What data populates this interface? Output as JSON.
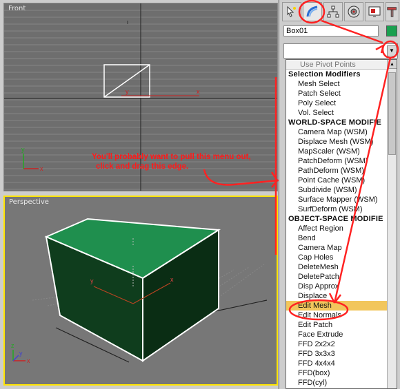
{
  "viewports": {
    "front": {
      "label": "Front",
      "axis_x": "x",
      "axis_y": "y",
      "gizmo_x": "x",
      "gizmo_y": "y"
    },
    "perspective": {
      "label": "Perspective",
      "axis_x": "x",
      "axis_y": "y",
      "gizmo_x": "x",
      "gizmo_y": "y",
      "gizmo_z": "z"
    }
  },
  "command_panel": {
    "tabs": [
      {
        "name": "create-tab",
        "icon": "pointer-star-icon"
      },
      {
        "name": "modify-tab",
        "icon": "modify-rainbow-icon"
      },
      {
        "name": "hierarchy-tab",
        "icon": "hierarchy-icon"
      },
      {
        "name": "motion-tab",
        "icon": "motion-icon"
      },
      {
        "name": "display-tab",
        "icon": "display-icon"
      },
      {
        "name": "utilities-tab",
        "icon": "hammer-icon"
      }
    ],
    "object_name": "Box01",
    "object_color": "#1aa050",
    "modifier_list": {
      "value": "",
      "use_pivot_points": "Use Pivot Points",
      "items": [
        {
          "label": "Selection Modifiers",
          "header": true
        },
        {
          "label": "Mesh Select"
        },
        {
          "label": "Patch Select"
        },
        {
          "label": "Poly Select"
        },
        {
          "label": "Vol. Select"
        },
        {
          "label": "WORLD-SPACE MODIFIE",
          "header": true
        },
        {
          "label": "Camera Map (WSM)"
        },
        {
          "label": "Displace Mesh (WSM)"
        },
        {
          "label": "MapScaler (WSM)"
        },
        {
          "label": "PatchDeform (WSM)"
        },
        {
          "label": "PathDeform (WSM)"
        },
        {
          "label": "Point Cache (WSM)"
        },
        {
          "label": "Subdivide (WSM)"
        },
        {
          "label": "Surface Mapper (WSM)"
        },
        {
          "label": "SurfDeform (WSM)"
        },
        {
          "label": "OBJECT-SPACE MODIFIE",
          "header": true
        },
        {
          "label": "Affect Region"
        },
        {
          "label": "Bend"
        },
        {
          "label": "Camera Map"
        },
        {
          "label": "Cap Holes"
        },
        {
          "label": "DeleteMesh"
        },
        {
          "label": "DeletePatch"
        },
        {
          "label": "Disp Approx"
        },
        {
          "label": "Displace"
        },
        {
          "label": "Edit Mesh",
          "selected": true
        },
        {
          "label": "Edit Normals"
        },
        {
          "label": "Edit Patch"
        },
        {
          "label": "Face Extrude"
        },
        {
          "label": "FFD 2x2x2"
        },
        {
          "label": "FFD 3x3x3"
        },
        {
          "label": "FFD 4x4x4"
        },
        {
          "label": "FFD(box)"
        },
        {
          "label": "FFD(cyl)"
        }
      ]
    }
  },
  "annotation": {
    "line1": "You'll probably want to pull this menu out,",
    "line2": "click and drag this edge.",
    "color": "#ff1a1a"
  },
  "colors": {
    "box_top": "#1f8f4e",
    "box_front": "#0f3d1d",
    "box_side": "#0a2d14",
    "selection_highlight": "#f2c65c",
    "active_viewport": "#ffe400"
  }
}
